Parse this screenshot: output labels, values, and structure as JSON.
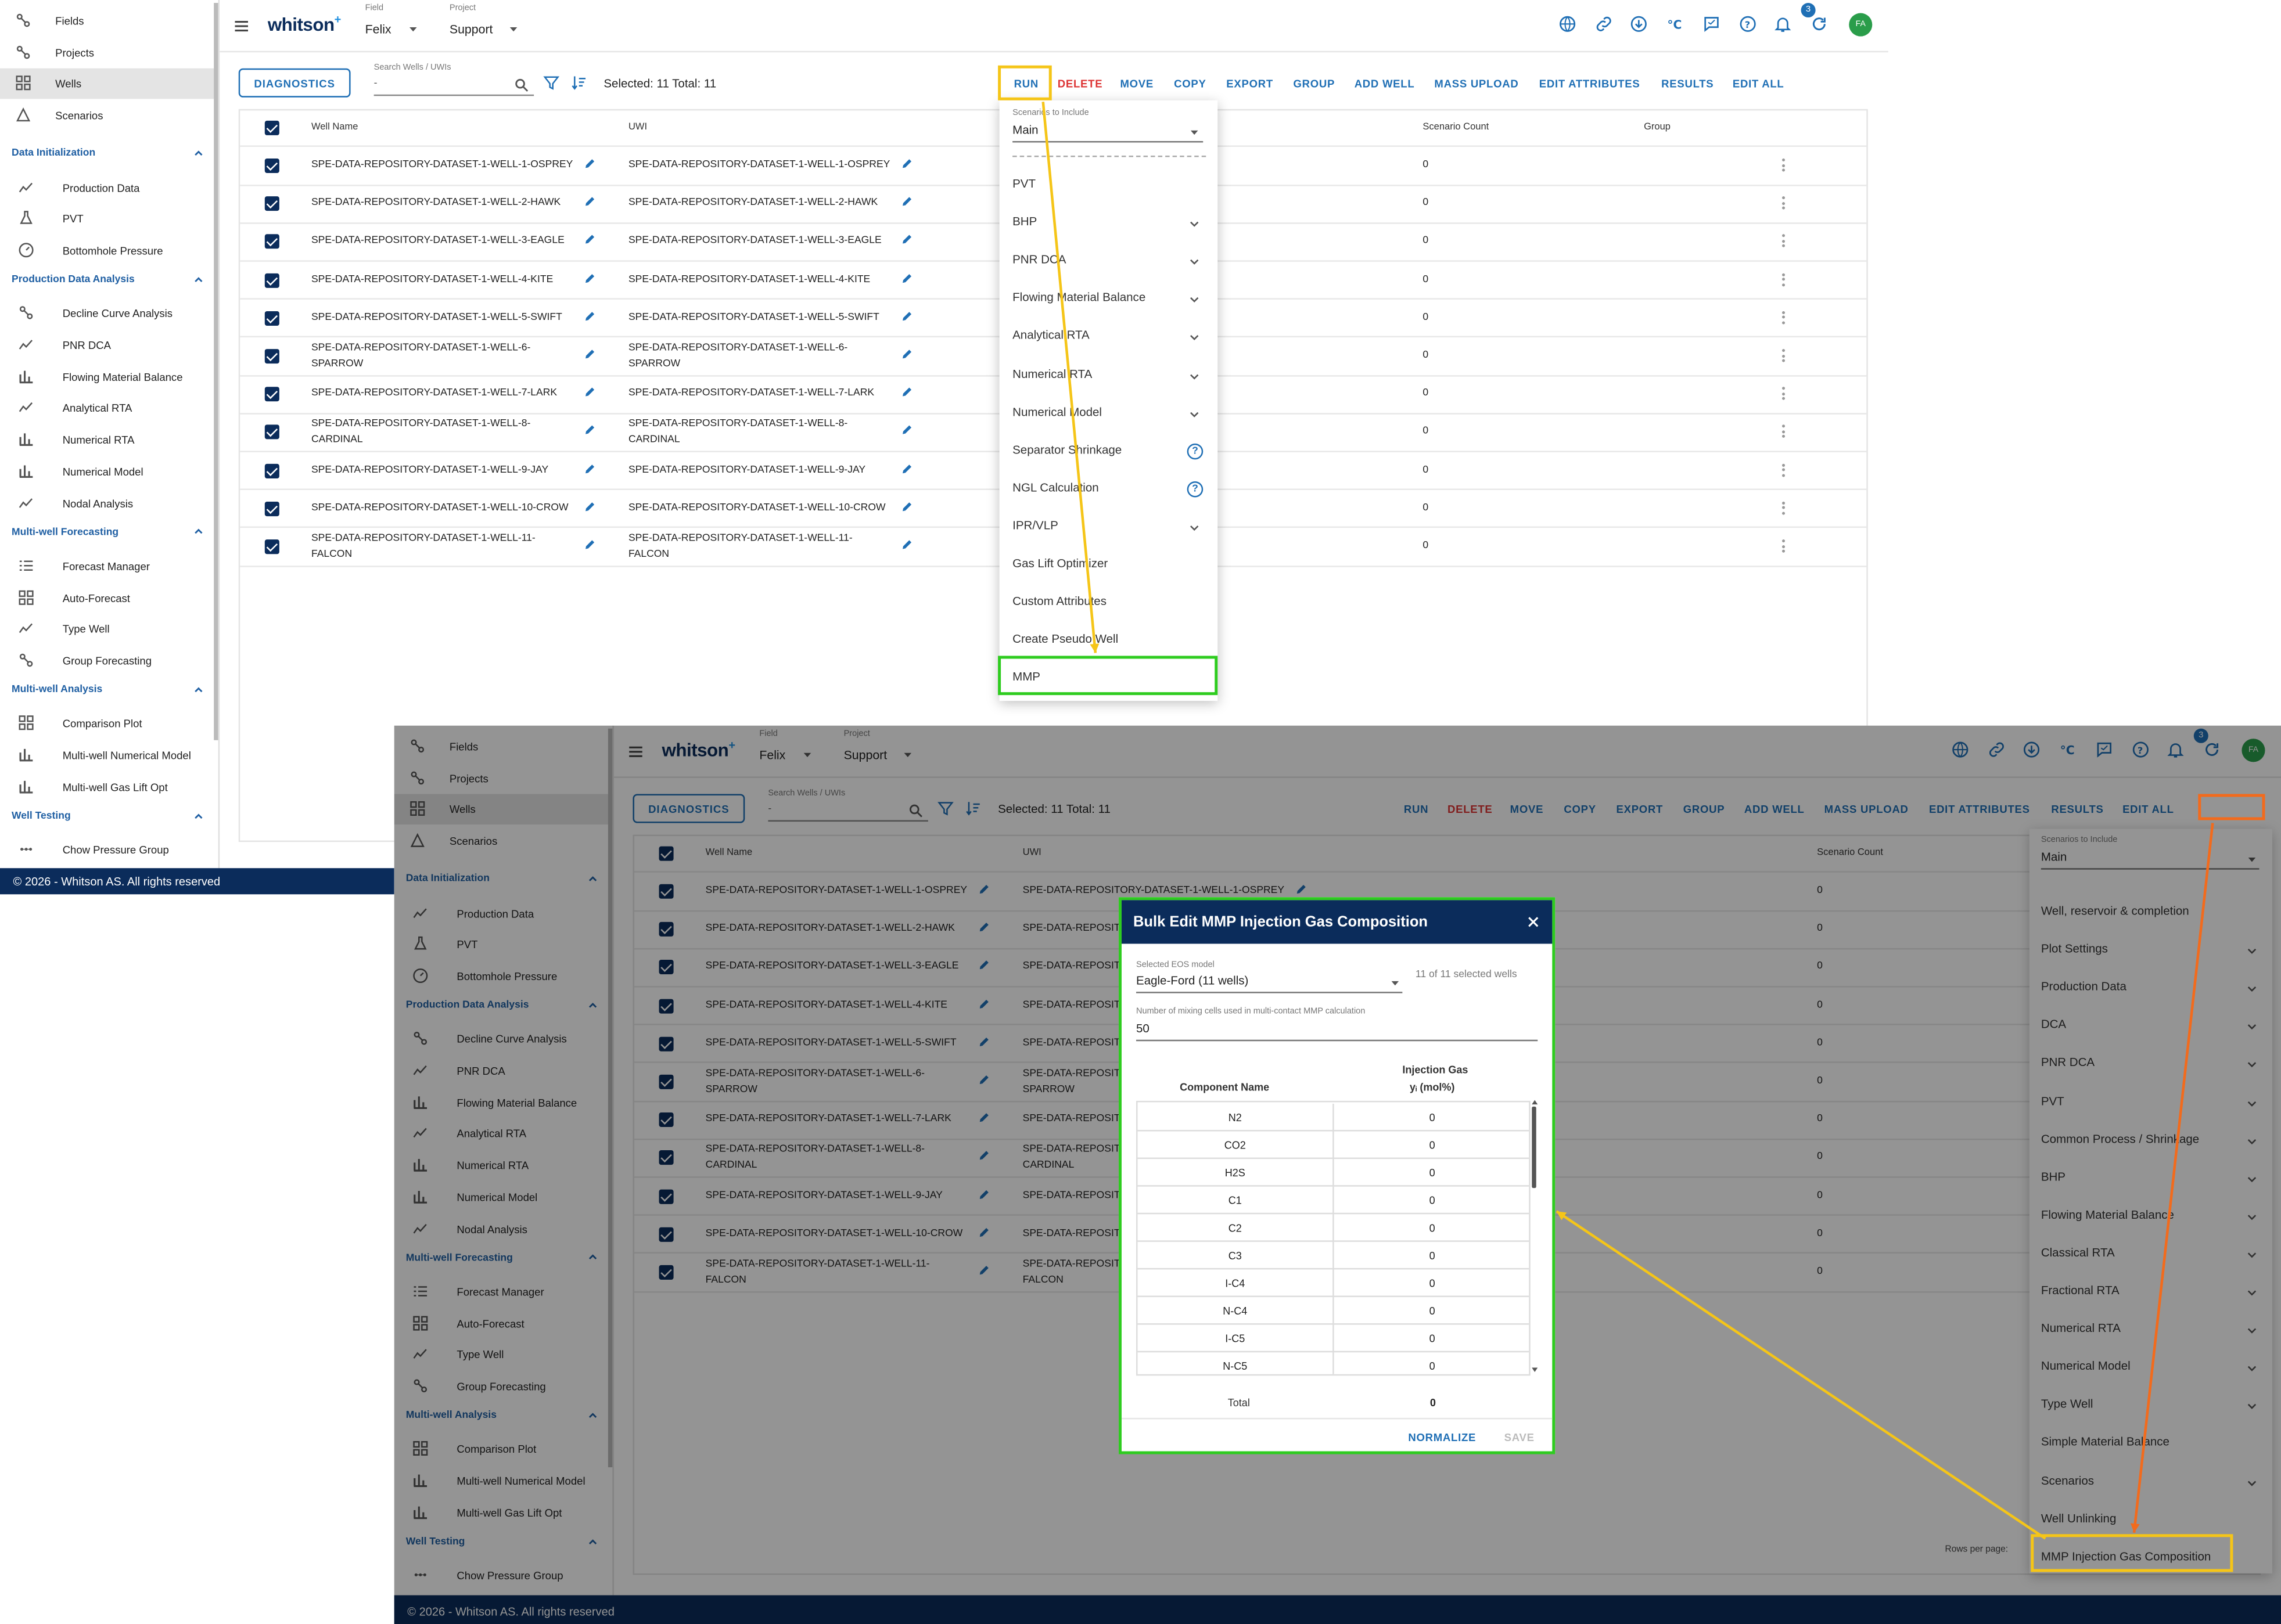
{
  "app": {
    "logo": "whitson",
    "logo_sup": "+",
    "field_label": "Field",
    "field_value": "Felix",
    "project_label": "Project",
    "project_value": "Support",
    "notif_count": "3",
    "avatar": "FA",
    "copyright": "© 2026 - Whitson AS. All rights reserved"
  },
  "sidebar": {
    "top": [
      {
        "label": "Fields",
        "icon": "fields-icon"
      },
      {
        "label": "Projects",
        "icon": "projects-icon"
      },
      {
        "label": "Wells",
        "icon": "wells-icon",
        "active": true
      },
      {
        "label": "Scenarios",
        "icon": "scenarios-icon"
      }
    ],
    "sections": [
      {
        "title": "Data Initialization",
        "items": [
          "Production Data",
          "PVT",
          "Bottomhole Pressure"
        ]
      },
      {
        "title": "Production Data Analysis",
        "items": [
          "Decline Curve Analysis",
          "PNR DCA",
          "Flowing Material Balance",
          "Analytical RTA",
          "Numerical RTA",
          "Numerical Model",
          "Nodal Analysis"
        ]
      },
      {
        "title": "Multi-well Forecasting",
        "items": [
          "Forecast Manager",
          "Auto-Forecast",
          "Type Well",
          "Group Forecasting"
        ]
      },
      {
        "title": "Multi-well Analysis",
        "items": [
          "Comparison Plot",
          "Multi-well Numerical Model",
          "Multi-well Gas Lift Opt"
        ]
      },
      {
        "title": "Well Testing",
        "items": [
          "Chow Pressure Group"
        ]
      }
    ]
  },
  "toolbar": {
    "diagnostics": "DIAGNOSTICS",
    "search_label": "Search Wells / UWIs",
    "search_value": "-",
    "selection": "Selected: 11 Total: 11",
    "actions": [
      "RUN",
      "DELETE",
      "MOVE",
      "COPY",
      "EXPORT",
      "GROUP",
      "ADD WELL",
      "MASS UPLOAD",
      "EDIT ATTRIBUTES",
      "RESULTS",
      "EDIT ALL"
    ]
  },
  "table": {
    "headers": {
      "well_name": "Well Name",
      "uwi": "UWI",
      "scenario_count": "Scenario Count",
      "group": "Group"
    },
    "rows": [
      {
        "name": [
          "SPE-DATA-REPOSITORY-DATASET-1-WELL-1-OSPREY"
        ],
        "count": "0"
      },
      {
        "name": [
          "SPE-DATA-REPOSITORY-DATASET-1-WELL-2-HAWK"
        ],
        "count": "0"
      },
      {
        "name": [
          "SPE-DATA-REPOSITORY-DATASET-1-WELL-3-EAGLE"
        ],
        "count": "0"
      },
      {
        "name": [
          "SPE-DATA-REPOSITORY-DATASET-1-WELL-4-KITE"
        ],
        "count": "0"
      },
      {
        "name": [
          "SPE-DATA-REPOSITORY-DATASET-1-WELL-5-SWIFT"
        ],
        "count": "0"
      },
      {
        "name": [
          "SPE-DATA-REPOSITORY-DATASET-1-WELL-6-",
          "SPARROW"
        ],
        "count": "0"
      },
      {
        "name": [
          "SPE-DATA-REPOSITORY-DATASET-1-WELL-7-LARK"
        ],
        "count": "0"
      },
      {
        "name": [
          "SPE-DATA-REPOSITORY-DATASET-1-WELL-8-",
          "CARDINAL"
        ],
        "count": "0"
      },
      {
        "name": [
          "SPE-DATA-REPOSITORY-DATASET-1-WELL-9-JAY"
        ],
        "count": "0"
      },
      {
        "name": [
          "SPE-DATA-REPOSITORY-DATASET-1-WELL-10-CROW"
        ],
        "count": "0"
      },
      {
        "name": [
          "SPE-DATA-REPOSITORY-DATASET-1-WELL-11-",
          "FALCON"
        ],
        "count": "0"
      }
    ],
    "uwi_overlay": [
      "SPE-DATA-REPOSITORY-DATASET-1-WELL-1-OSPREY",
      "SPE-DATA-REPOSIT",
      "SPE-DATA-REPOSIT",
      "SPE-DATA-REPOSIT",
      "SPE-DATA-REPOSIT",
      "SPE-DATA-REPOSIT",
      "SPE-DATA-REPOSIT",
      "SPE-DATA-REPOSIT",
      "SPE-DATA-REPOSIT",
      "SPE-DATA-REPOSIT",
      "SPE-DATA-REPOSIT"
    ],
    "uwi_overlay_second": [
      "",
      "",
      "",
      "",
      "",
      "SPARROW",
      "",
      "CARDINAL",
      "",
      "",
      "FALCON"
    ],
    "rows_per_page": "Rows per page:"
  },
  "run_menu": {
    "scenarios_label": "Scenarios to Include",
    "scenarios_value": "Main",
    "items": [
      {
        "label": "PVT"
      },
      {
        "label": "BHP",
        "chevron": true
      },
      {
        "label": "PNR DCA",
        "chevron": true
      },
      {
        "label": "Flowing Material Balance",
        "chevron": true
      },
      {
        "label": "Analytical RTA",
        "chevron": true
      },
      {
        "label": "Numerical RTA",
        "chevron": true
      },
      {
        "label": "Numerical Model",
        "chevron": true
      },
      {
        "label": "Separator Shrinkage",
        "help": true
      },
      {
        "label": "NGL Calculation",
        "help": true
      },
      {
        "label": "IPR/VLP",
        "chevron": true
      },
      {
        "label": "Gas Lift Optimizer"
      },
      {
        "label": "Custom Attributes"
      },
      {
        "label": "Create Pseudo Well"
      },
      {
        "label": "MMP"
      }
    ]
  },
  "edit_all_menu": {
    "scenarios_label": "Scenarios to Include",
    "scenarios_value": "Main",
    "items": [
      {
        "label": "Well, reservoir & completion"
      },
      {
        "label": "Plot Settings",
        "chevron": true
      },
      {
        "label": "Production Data",
        "chevron": true
      },
      {
        "label": "DCA",
        "chevron": true
      },
      {
        "label": "PNR DCA",
        "chevron": true
      },
      {
        "label": "PVT",
        "chevron": true
      },
      {
        "label": "Common Process / Shrinkage",
        "chevron": true
      },
      {
        "label": "BHP",
        "chevron": true
      },
      {
        "label": "Flowing Material Balance",
        "chevron": true
      },
      {
        "label": "Classical RTA",
        "chevron": true
      },
      {
        "label": "Fractional RTA",
        "chevron": true
      },
      {
        "label": "Numerical RTA",
        "chevron": true
      },
      {
        "label": "Numerical Model",
        "chevron": true
      },
      {
        "label": "Type Well",
        "chevron": true
      },
      {
        "label": "Simple Material Balance"
      },
      {
        "label": "Scenarios",
        "chevron": true
      },
      {
        "label": "Well Unlinking"
      },
      {
        "label": "MMP Injection Gas Composition"
      }
    ]
  },
  "dialog": {
    "title": "Bulk Edit MMP Injection Gas Composition",
    "eos_label": "Selected EOS model",
    "eos_value": "Eagle-Ford (11 wells)",
    "wells_note": "11 of 11 selected wells",
    "cells_label": "Number of mixing cells used in multi-contact MMP calculation",
    "cells_value": "50",
    "col_component": "Component Name",
    "col_gas": "Injection Gas",
    "col_gas_unit": "yᵢ (mol%)",
    "components": [
      {
        "name": "N2",
        "value": "0"
      },
      {
        "name": "CO2",
        "value": "0"
      },
      {
        "name": "H2S",
        "value": "0"
      },
      {
        "name": "C1",
        "value": "0"
      },
      {
        "name": "C2",
        "value": "0"
      },
      {
        "name": "C3",
        "value": "0"
      },
      {
        "name": "I-C4",
        "value": "0"
      },
      {
        "name": "N-C4",
        "value": "0"
      },
      {
        "name": "I-C5",
        "value": "0"
      },
      {
        "name": "N-C5",
        "value": "0"
      }
    ],
    "total_label": "Total",
    "total_value": "0",
    "normalize": "NORMALIZE",
    "save": "SAVE"
  },
  "colors": {
    "navy": "#0b2c5b",
    "blue": "#1f6fb5",
    "red": "#d33",
    "highlight_yellow": "#f5c518",
    "highlight_green": "#2ecc1f",
    "highlight_orange": "#f26b1d"
  }
}
